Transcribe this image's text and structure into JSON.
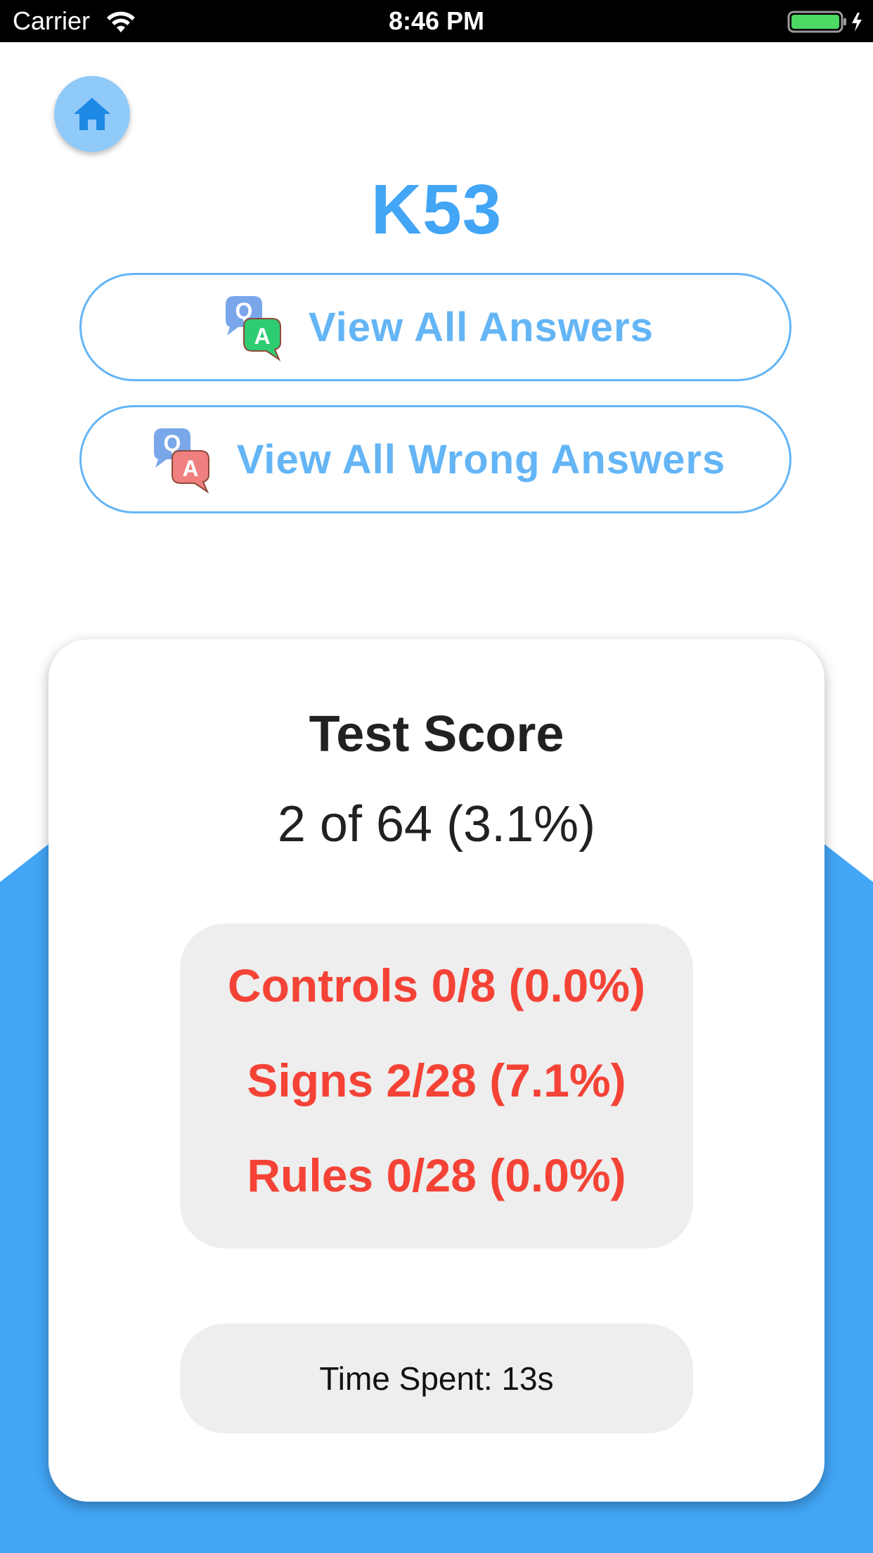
{
  "status_bar": {
    "carrier": "Carrier",
    "time": "8:46 PM",
    "battery_color": "#4cd964"
  },
  "header": {
    "home_icon": "home-icon",
    "title": "K53"
  },
  "actions": {
    "view_all_answers": {
      "label": "View All Answers",
      "icon": "qa-icon",
      "answer_bubble_color": "#2ecc71"
    },
    "view_wrong_answers": {
      "label": "View All Wrong Answers",
      "icon": "qa-wrong-icon",
      "answer_bubble_color": "#f08080"
    }
  },
  "score_card": {
    "title": "Test Score",
    "score": "2 of 64 (3.1%)",
    "categories": [
      {
        "text": "Controls 0/8 (0.0%)"
      },
      {
        "text": "Signs 2/28 (7.1%)"
      },
      {
        "text": "Rules 0/28 (0.0%)"
      }
    ],
    "time_spent": "Time Spent: 13s"
  },
  "colors": {
    "accent": "#42a5f5",
    "button_text": "#64b5f6",
    "category_text": "#f44336",
    "question_bubble": "#7aa7ea"
  }
}
